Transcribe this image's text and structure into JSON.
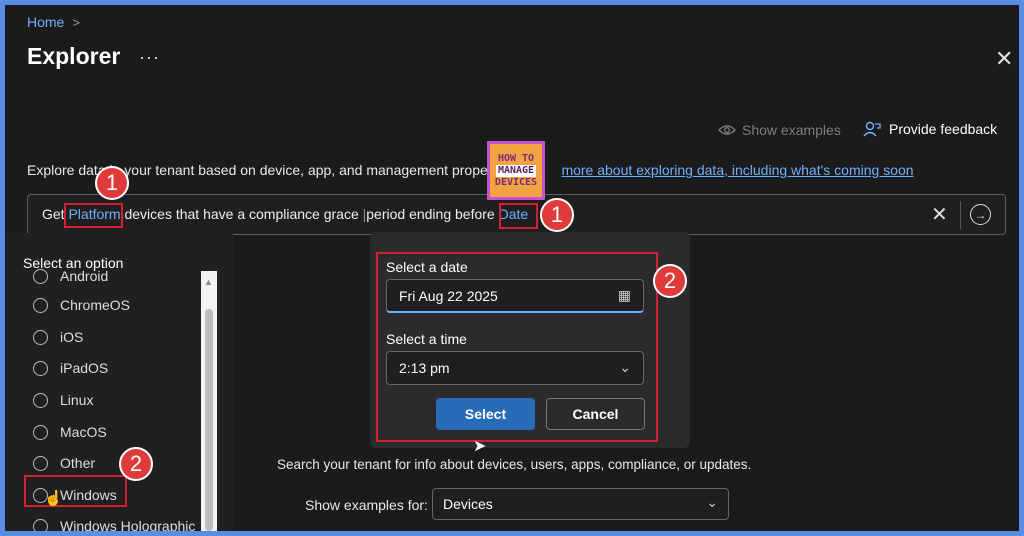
{
  "breadcrumb": {
    "home": "Home",
    "chevron": ">"
  },
  "page": {
    "title": "Explorer",
    "more_icon": "···",
    "close_icon": "✕"
  },
  "toolbar": {
    "show_examples": "Show examples",
    "provide_feedback": "Provide feedback"
  },
  "description": {
    "text": "Explore data in your tenant based on device, app, and management properti",
    "link": "more about exploring data, including what's coming soon"
  },
  "query": {
    "prefix": "Get ",
    "platform_token": "Platform",
    "middle": " devices that have a compliance grace ",
    "after_cut": "period ending before ",
    "date_token": "Date",
    "clear_icon": "✕",
    "go_icon": "→"
  },
  "options_panel": {
    "title": "Select an option",
    "items": [
      "Android",
      "ChromeOS",
      "iOS",
      "iPadOS",
      "Linux",
      "MacOS",
      "Other",
      "Windows",
      "Windows Holographic"
    ]
  },
  "date_popup": {
    "date_label": "Select a date",
    "date_value": "Fri Aug 22 2025",
    "time_label": "Select a time",
    "time_value": "2:13 pm",
    "select_label": "Select",
    "cancel_label": "Cancel"
  },
  "search_note": "Search your tenant for info about devices, users, apps, compliance, or updates.",
  "examples": {
    "label": "Show examples for:",
    "value": "Devices"
  },
  "annotations": {
    "badge_1": "1",
    "badge_2": "2"
  },
  "watermark": {
    "line1": "HOW TO",
    "line2": "MANAGE",
    "line3": "DEVICES"
  },
  "colors": {
    "accent": "#6fb0ff",
    "highlight": "#d6202f",
    "primary_button": "#2a6bb8"
  }
}
